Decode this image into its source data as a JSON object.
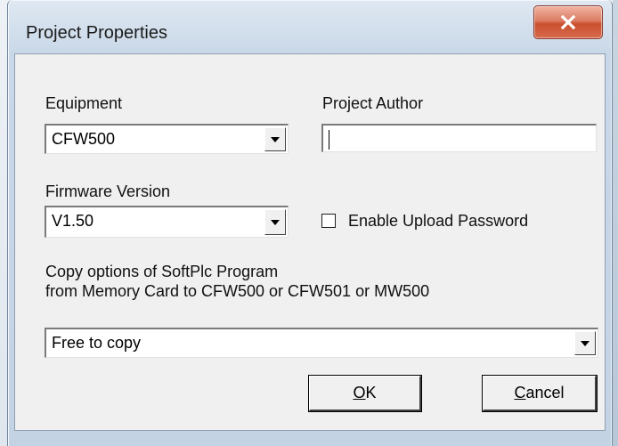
{
  "window": {
    "title": "Project Properties"
  },
  "form": {
    "equipment": {
      "label": "Equipment",
      "value": "CFW500"
    },
    "project_author": {
      "label": "Project Author",
      "value": ""
    },
    "firmware_version": {
      "label": "Firmware Version",
      "value": "V1.50"
    },
    "upload_password": {
      "label": "Enable Upload Password",
      "checked": false
    },
    "copy_options": {
      "label_line1": "Copy options of SoftPlc Program",
      "label_line2": "from Memory Card to CFW500 or CFW501 or MW500",
      "value": "Free to copy"
    }
  },
  "buttons": {
    "ok": {
      "mnemonic": "O",
      "rest": "K"
    },
    "cancel": {
      "mnemonic": "C",
      "rest": "ancel"
    }
  },
  "icons": {
    "close": "close-icon",
    "dropdown": "chevron-down-icon"
  },
  "colors": {
    "close_button": "#c9502f",
    "dialog_face": "#f0f0f0"
  }
}
